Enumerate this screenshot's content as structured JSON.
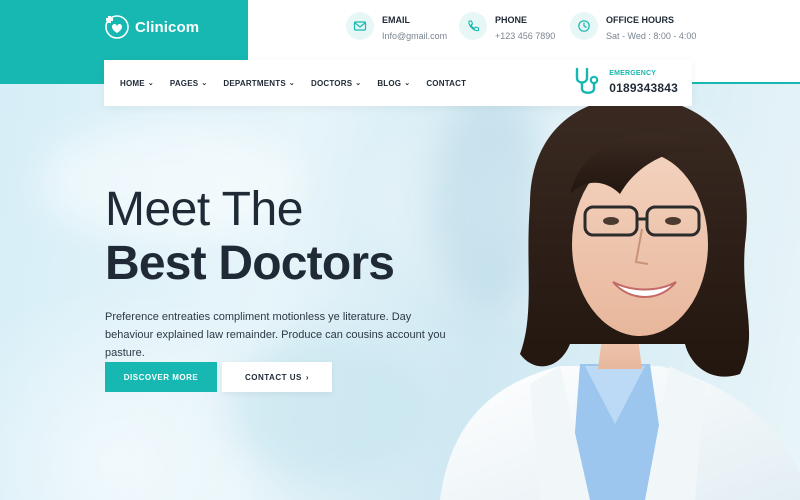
{
  "brand": {
    "name": "Clinicom",
    "color": "#17b8b1"
  },
  "contact": {
    "email": {
      "icon": "envelope-icon",
      "title": "EMAIL",
      "value": "Info@gmail.com"
    },
    "phone": {
      "icon": "phone-icon",
      "title": "PHONE",
      "value": "+123 456 7890"
    },
    "hours": {
      "icon": "clock-icon",
      "title": "OFFICE HOURS",
      "value": "Sat - Wed : 8:00 - 4:00"
    }
  },
  "nav": {
    "items": [
      {
        "label": "HOME",
        "has_dropdown": true
      },
      {
        "label": "PAGES",
        "has_dropdown": true
      },
      {
        "label": "DEPARTMENTS",
        "has_dropdown": true
      },
      {
        "label": "DOCTORS",
        "has_dropdown": true
      },
      {
        "label": "BLOG",
        "has_dropdown": true
      },
      {
        "label": "CONTACT",
        "has_dropdown": false
      }
    ],
    "chevron": "⌄"
  },
  "emergency": {
    "icon": "stethoscope-icon",
    "label": "EMERGENCY",
    "number": "0189343843"
  },
  "hero": {
    "headline_light": "Meet The",
    "headline_bold": "Best Doctors",
    "description": "Preference entreaties compliment motionless ye literature. Day behaviour explained law remainder. Produce can cousins account you pasture.",
    "primary_button": "DISCOVER MORE",
    "secondary_button": "CONTACT US",
    "secondary_arrow": "›"
  },
  "colors": {
    "accent": "#17b8b1",
    "text_dark": "#1f2a36",
    "text_muted": "#7a8591"
  }
}
